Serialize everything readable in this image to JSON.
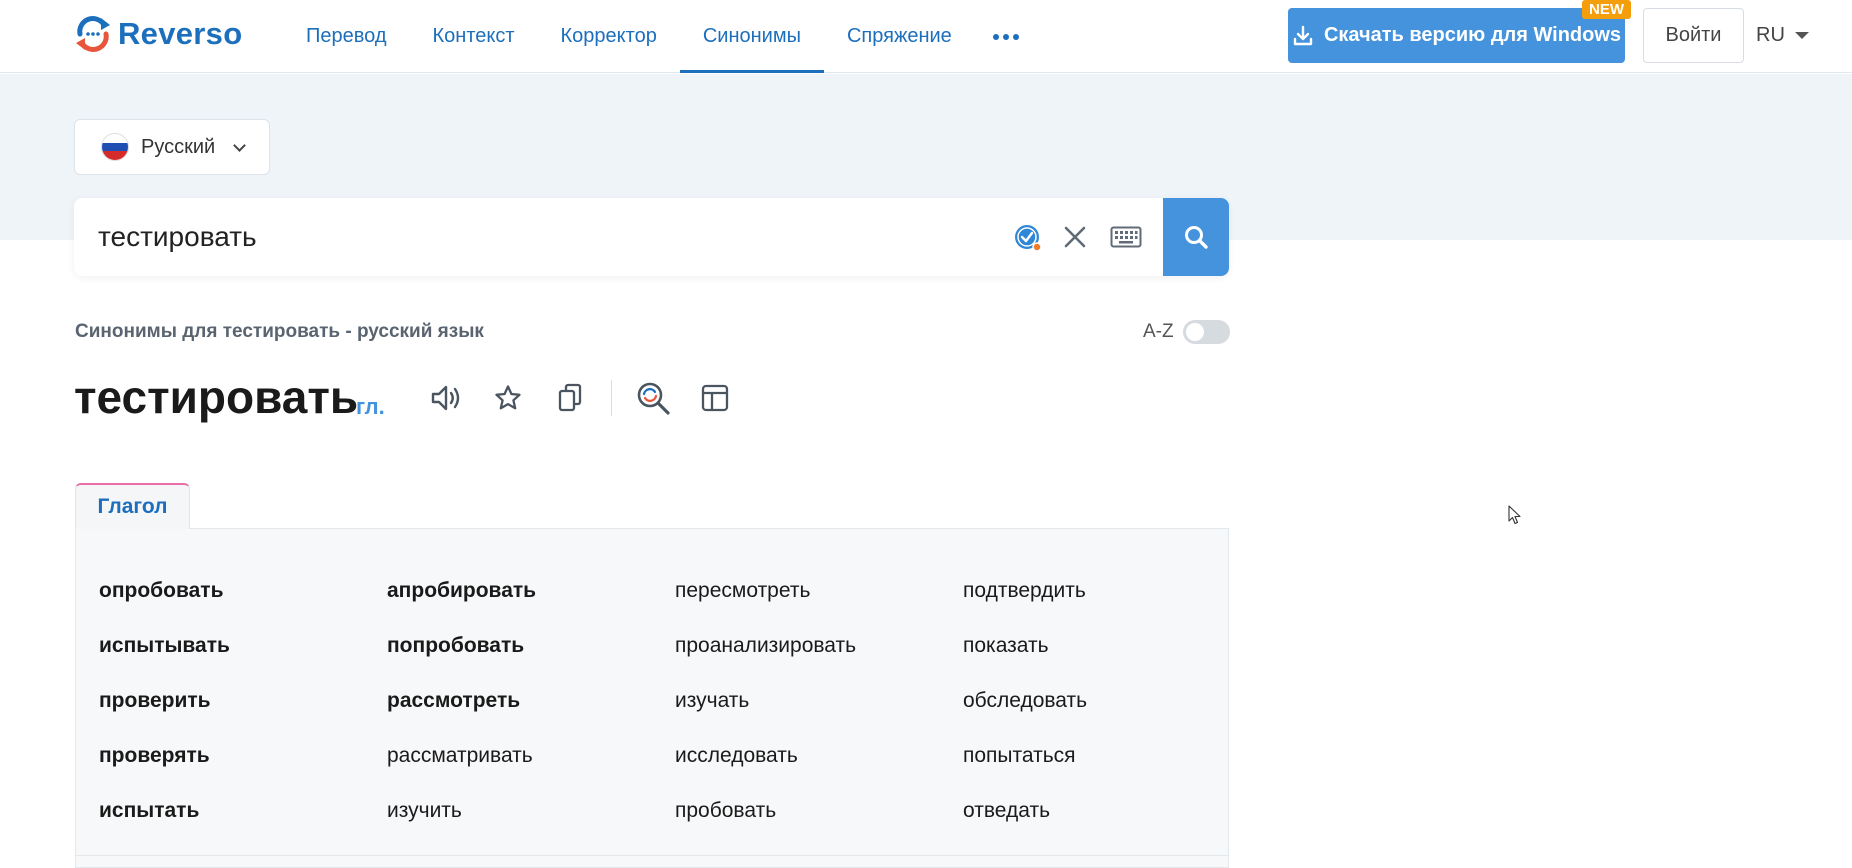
{
  "header": {
    "logo_text": "Reverso",
    "nav": [
      {
        "label": "Перевод",
        "active": false
      },
      {
        "label": "Контекст",
        "active": false
      },
      {
        "label": "Корректор",
        "active": false
      },
      {
        "label": "Синонимы",
        "active": true
      },
      {
        "label": "Спряжение",
        "active": false
      }
    ],
    "download_label": "Скачать версию для Windows",
    "new_badge": "NEW",
    "login_label": "Войти",
    "ui_lang": "RU"
  },
  "search": {
    "language": "Русский",
    "query": "тестировать"
  },
  "results": {
    "subtitle": "Синонимы для тестировать - русский язык",
    "az_label": "A-Z",
    "az_sort_on": false,
    "headword": "тестировать",
    "pos": "гл.",
    "tab_label": "Глагол",
    "synonyms": [
      {
        "word": "опробовать",
        "strong": true
      },
      {
        "word": "апробировать",
        "strong": true
      },
      {
        "word": "пересмотреть",
        "strong": false
      },
      {
        "word": "подтвердить",
        "strong": false
      },
      {
        "word": "испытывать",
        "strong": true
      },
      {
        "word": "попробовать",
        "strong": true
      },
      {
        "word": "проанализировать",
        "strong": false
      },
      {
        "word": "показать",
        "strong": false
      },
      {
        "word": "проверить",
        "strong": true
      },
      {
        "word": "рассмотреть",
        "strong": true
      },
      {
        "word": "изучать",
        "strong": false
      },
      {
        "word": "обследовать",
        "strong": false
      },
      {
        "word": "проверять",
        "strong": true
      },
      {
        "word": "рассматривать",
        "strong": false
      },
      {
        "word": "исследовать",
        "strong": false
      },
      {
        "word": "попытаться",
        "strong": false
      },
      {
        "word": "испытать",
        "strong": true
      },
      {
        "word": "изучить",
        "strong": false
      },
      {
        "word": "пробовать",
        "strong": false
      },
      {
        "word": "отведать",
        "strong": false
      }
    ]
  },
  "colors": {
    "brand_blue": "#1c6fbd",
    "button_blue": "#4593dd",
    "badge_orange": "#f59e0b",
    "tab_accent": "#e96da6",
    "band_bg": "#eff4f8"
  },
  "icons": [
    "reverso-logo-icon",
    "download-icon",
    "more-dots-icon",
    "russia-flag-icon",
    "chevron-down-icon",
    "spellcheck-icon",
    "clear-icon",
    "keyboard-icon",
    "search-icon",
    "speaker-icon",
    "star-icon",
    "copy-icon",
    "context-search-icon",
    "conjugation-table-icon",
    "mouse-cursor-icon"
  ]
}
